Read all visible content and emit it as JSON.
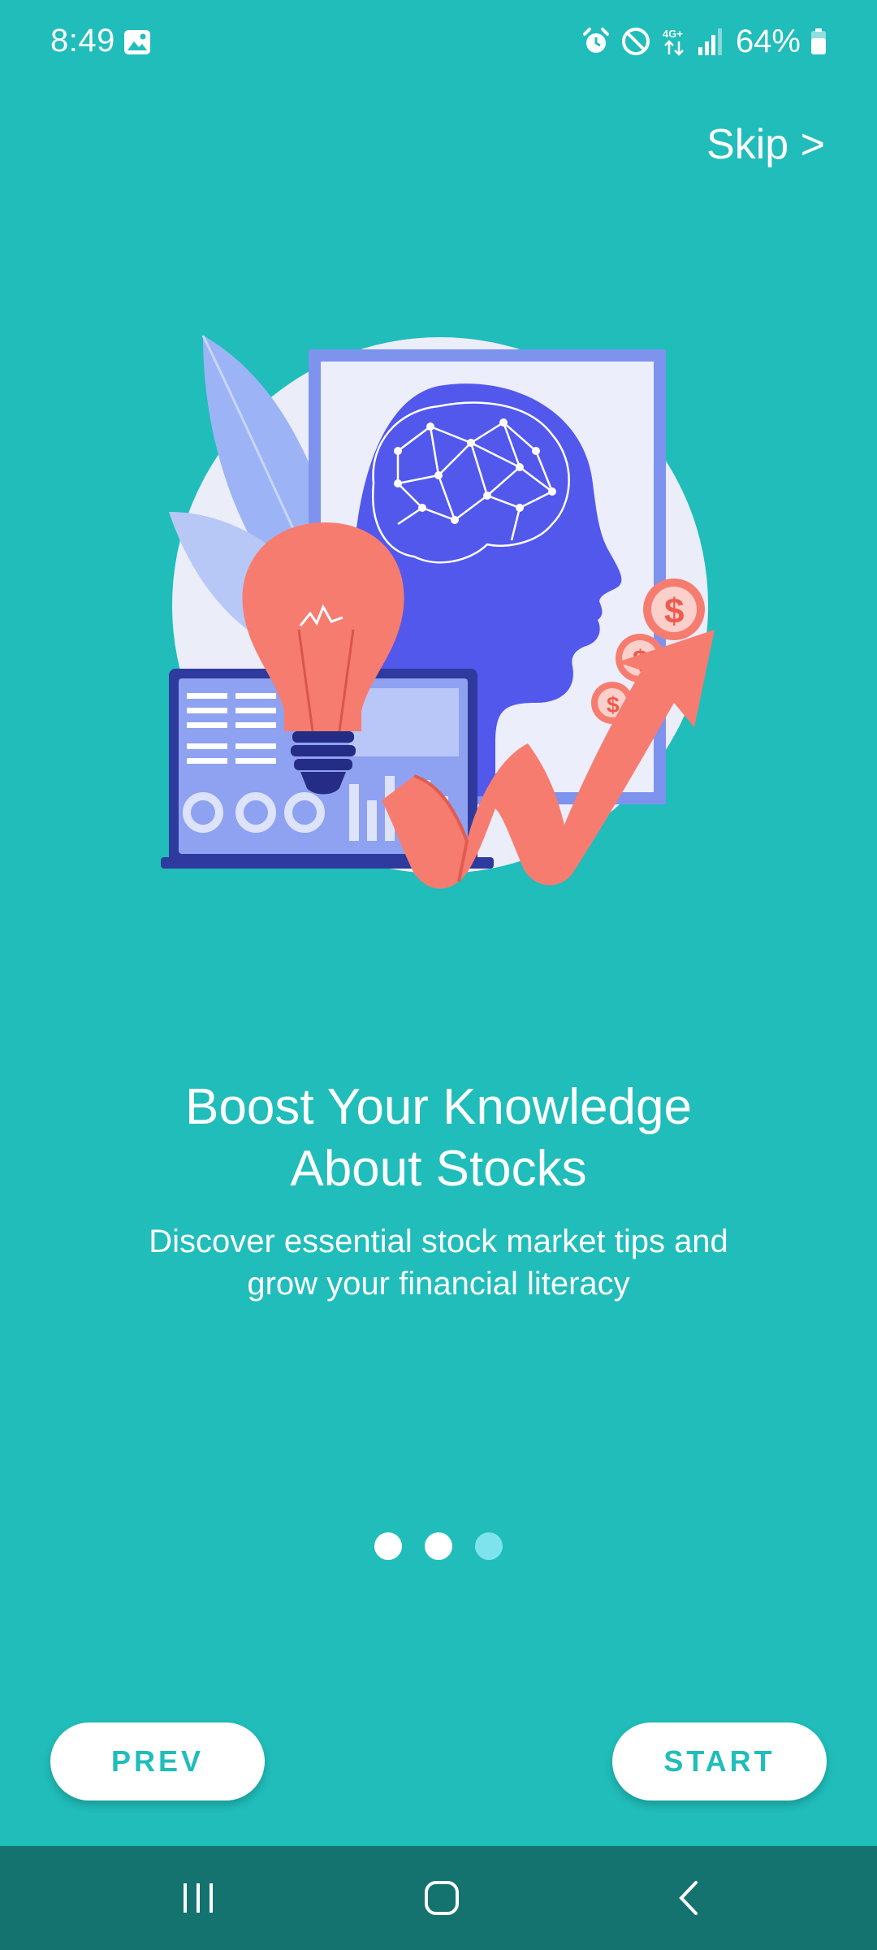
{
  "status_bar": {
    "time": "8:49",
    "battery": "64%",
    "icons": [
      "gallery-icon",
      "alarm-icon",
      "do-not-disturb-icon",
      "4g-lte-icon",
      "signal-icon",
      "battery-icon"
    ]
  },
  "header": {
    "skip_label": "Skip >"
  },
  "illustration": {
    "description_icon": "stock-knowledge-illustration"
  },
  "content": {
    "title_line1": "Boost Your Knowledge",
    "title_line2": "About Stocks",
    "subtitle_line1": "Discover essential stock market tips and",
    "subtitle_line2": "grow your financial literacy"
  },
  "pager": {
    "total": 3,
    "active_index": 2
  },
  "buttons": {
    "prev_label": "PREV",
    "start_label": "START"
  },
  "colors": {
    "background": "#20BDBA",
    "nav_bar": "#14726F",
    "button_text": "#20BDBA",
    "active_dot": "#7FE3EE"
  },
  "nav_bar": {
    "items": [
      "recent-apps-icon",
      "home-icon",
      "back-icon"
    ]
  }
}
